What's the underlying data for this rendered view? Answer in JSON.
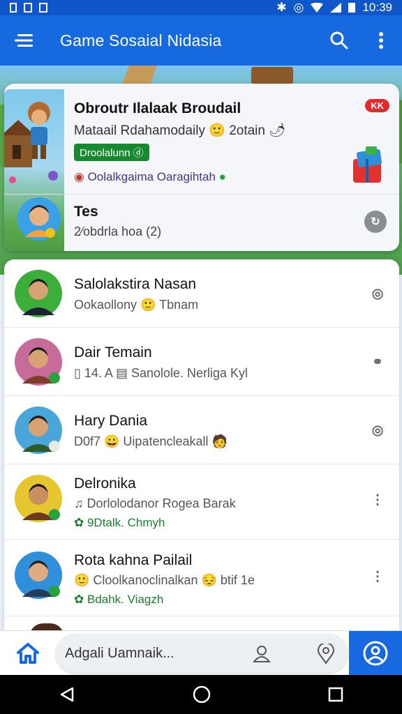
{
  "status_bar": {
    "time": "10:39"
  },
  "app_bar": {
    "title": "Game Sosaial Nidasia"
  },
  "featured": {
    "title": "Obroutr Ilalaak Broudail",
    "subtitle": "Mataail Rdahamodaily 🙂 2otain 🌶",
    "green_badge": "Droolalunn ⓓ",
    "badge": "KK",
    "purple_line": "Oolalkgaima Oaragihtah",
    "friend_name": "Tes",
    "friend_sub": "2⁄obdrla hoa (2)"
  },
  "friends": [
    {
      "name": "Salolakstira Nasan",
      "line1": "Ookaollony 🙂 Tbnam",
      "line2": ""
    },
    {
      "name": "Dair Temain",
      "line1": "▯ 14. A ▤ Sanolole. Nerliga Kyl",
      "line2": ""
    },
    {
      "name": "Hary Dania",
      "line1": "D0f7 😀 Uipatencleakall 🧑",
      "line2": ""
    },
    {
      "name": "Delronika",
      "line1": "♫ Dorlolodanor Rogea Barak",
      "line2": "✿ 9Dtalk. Chmyh"
    },
    {
      "name": "Rota kahna Pailail",
      "line1": "🙂 Cloolkanoclinalkan 😔 btif 1e",
      "line2": "✿ Bdahk. Viagzh"
    }
  ],
  "bottom_nav": {
    "input_placeholder": "Adgali Uamnaik..."
  },
  "colors": {
    "primary": "#1769e0",
    "status_bar": "#0f57c9",
    "green": "#17892f",
    "red": "#e22a2a",
    "purple": "#47338a"
  }
}
